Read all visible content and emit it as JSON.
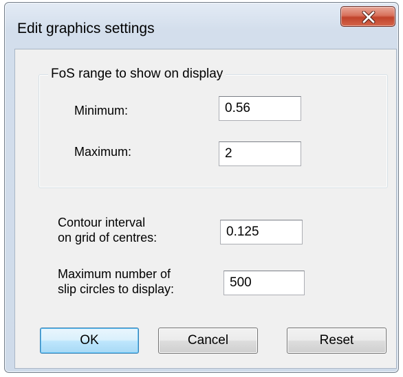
{
  "dialog": {
    "title": "Edit graphics settings",
    "close_glyph": "X"
  },
  "fos_group": {
    "label": "FoS range to show on display",
    "minimum_label": "Minimum:",
    "minimum_value": "0.56",
    "maximum_label": "Maximum:",
    "maximum_value": "2"
  },
  "contour": {
    "label_line1": "Contour interval",
    "label_line2": "on grid of centres:",
    "value": "0.125"
  },
  "slip": {
    "label_line1": "Maximum number of",
    "label_line2": "slip circles to display:",
    "value": "500"
  },
  "buttons": {
    "ok": "OK",
    "cancel": "Cancel",
    "reset": "Reset"
  },
  "icons": {
    "close": "close-icon"
  },
  "colors": {
    "close_button": "#c9503a",
    "default_button_border": "#3c7fb1",
    "window_frame": "#cfdbea",
    "client_background": "#f0f0f0"
  }
}
